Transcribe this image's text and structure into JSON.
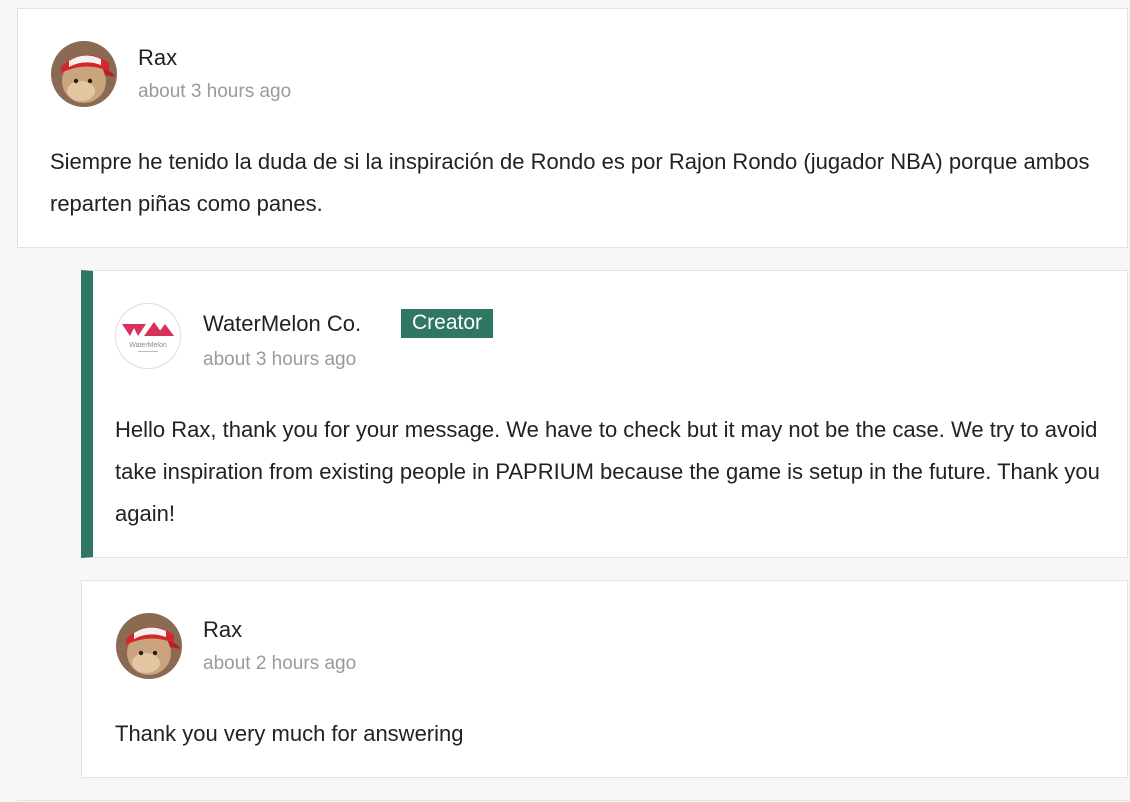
{
  "comments": [
    {
      "author": "Rax",
      "time": "about 3 hours ago",
      "avatar": "cat-with-red-cap-avatar",
      "body": "Siempre he tenido la duda de si la inspiración de Rondo es por Rajon Rondo (jugador NBA) porque ambos reparten piñas como panes."
    },
    {
      "author": "WaterMelon Co.",
      "badge": "Creator",
      "time": "about 3 hours ago",
      "avatar": "watermelon-logo-avatar",
      "logo_text": "WaterMelon",
      "body": "Hello Rax, thank you for your message. We have to check but it may not be the case. We try to avoid take inspiration from existing people in PAPRIUM because the game is setup in the future. Thank you again!"
    },
    {
      "author": "Rax",
      "time": "about 2 hours ago",
      "avatar": "cat-with-red-cap-avatar",
      "body": "Thank you very much for answering"
    }
  ],
  "colors": {
    "creator_accent": "#2f7763",
    "logo_pink": "#d8315b",
    "timestamp_gray": "#9a9a9a"
  }
}
